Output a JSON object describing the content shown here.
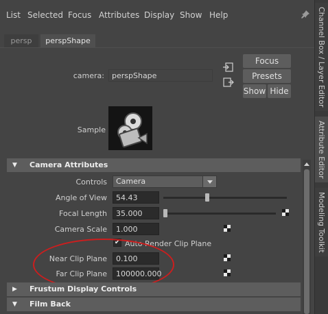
{
  "menubar": {
    "items": [
      "List",
      "Selected",
      "Focus",
      "Attributes",
      "Display",
      "Show",
      "Help"
    ]
  },
  "tabs": [
    "persp",
    "perspShape"
  ],
  "camera": {
    "label": "camera:",
    "value": "perspShape"
  },
  "buttons": {
    "focus": "Focus",
    "presets": "Presets",
    "show": "Show",
    "hide": "Hide"
  },
  "sample_label": "Sample",
  "sections": {
    "camera_attributes": "Camera Attributes",
    "frustum": "Frustum Display Controls",
    "film_back": "Film Back"
  },
  "attributes": {
    "controls": {
      "label": "Controls",
      "value": "Camera"
    },
    "angle_of_view": {
      "label": "Angle of View",
      "value": "54.43",
      "slider_fraction": 0.35
    },
    "focal_length": {
      "label": "Focal Length",
      "value": "35.000",
      "slider_fraction": 0.0
    },
    "camera_scale": {
      "label": "Camera Scale",
      "value": "1.000"
    },
    "auto_render_clip_plane": {
      "label": "Auto Render Clip Plane",
      "checked": true
    },
    "near_clip_plane": {
      "label": "Near Clip Plane",
      "value": "0.100"
    },
    "far_clip_plane": {
      "label": "Far Clip Plane",
      "value": "100000.000"
    }
  },
  "side_tabs": [
    "Channel Box / Layer Editor",
    "Attribute Editor",
    "Modeling Toolkit"
  ],
  "colors": {
    "background": "#444444",
    "field": "#2b2b2b",
    "section_header": "#5d5d5d",
    "annotation": "#cc1e1e"
  }
}
